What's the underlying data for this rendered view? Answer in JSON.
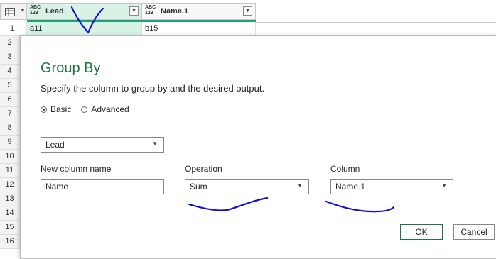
{
  "grid": {
    "columns": [
      {
        "type_icon_top": "ABC",
        "type_icon_bottom": "123",
        "name": "Lead"
      },
      {
        "type_icon_top": "ABC",
        "type_icon_bottom": "123",
        "name": "Name.1"
      }
    ],
    "first_row": {
      "row_number": "1",
      "lead": "a11",
      "name1": "b15"
    },
    "row_numbers": [
      "2",
      "3",
      "4",
      "5",
      "6",
      "7",
      "8",
      "9",
      "10",
      "11",
      "12",
      "13",
      "14",
      "15",
      "16"
    ]
  },
  "dialog": {
    "title": "Group By",
    "subtitle": "Specify the column to group by and the desired output.",
    "mode_basic_label": "Basic",
    "mode_advanced_label": "Advanced",
    "selected_mode": "Basic",
    "group_by_value": "Lead",
    "new_column_label": "New column name",
    "operation_label": "Operation",
    "column_label": "Column",
    "new_column_value": "Name",
    "operation_value": "Sum",
    "column_value": "Name.1",
    "ok_label": "OK",
    "cancel_label": "Cancel"
  },
  "colors": {
    "accent": "#217346",
    "selected_column_bg": "#d9f2e6",
    "column_bar": "#1aa37a",
    "annotation_ink": "#1010d0"
  }
}
